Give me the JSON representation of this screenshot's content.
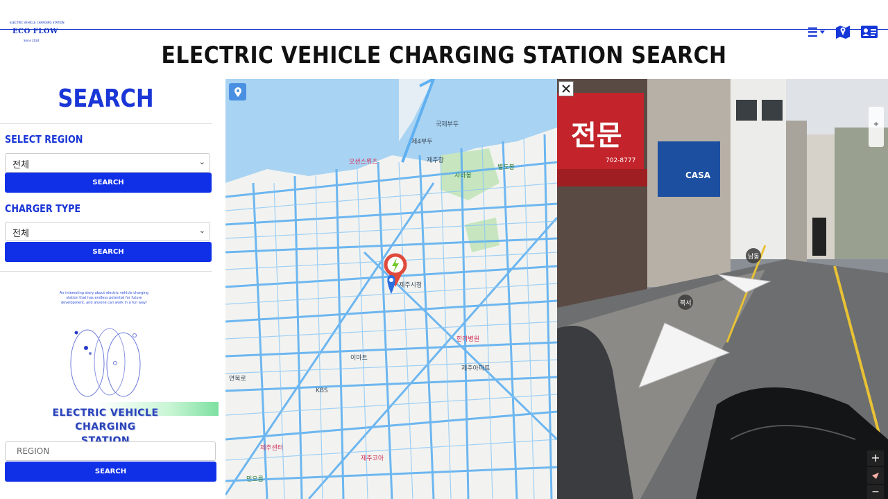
{
  "header": {
    "logo_tagline": "ELECTRIC VEHICLE CHARGING STATION",
    "logo_name": "ECO FLOW",
    "logo_since": "Since 2024",
    "title": "ELECTRIC VEHICLE CHARGING STATION SEARCH",
    "icons": [
      "menu-dropdown-icon",
      "map-icon",
      "id-card-icon"
    ]
  },
  "sidebar": {
    "heading": "SEARCH",
    "region_label": "SELECT REGION",
    "region_value": "전체",
    "region_button": "SEARCH",
    "charger_label": "CHARGER TYPE",
    "charger_value": "전체",
    "charger_button": "SEARCH",
    "story_text": "An interesting story about electric vehicle charging station that has endless potential for future development, and anyone can work in a fun way!",
    "ev_label_line1": "ELECTRIC VEHICLE CHARGING",
    "ev_label_line2": "STATION",
    "region_input_placeholder": "REGION",
    "bottom_button": "SEARCH"
  },
  "map": {
    "labels": [
      {
        "text": "국제부두",
        "id": "l1"
      },
      {
        "text": "제4부두",
        "id": "l2"
      },
      {
        "text": "제주항",
        "id": "l3"
      },
      {
        "text": "오션스위츠",
        "id": "l4"
      },
      {
        "text": "사라봉",
        "id": "l5"
      },
      {
        "text": "별도봉",
        "id": "l6"
      },
      {
        "text": "제주시청",
        "id": "l7"
      },
      {
        "text": "한라병원",
        "id": "l8"
      },
      {
        "text": "제주아파트",
        "id": "l9"
      },
      {
        "text": "이마트",
        "id": "l10"
      },
      {
        "text": "민오름",
        "id": "l11"
      },
      {
        "text": "제주코아",
        "id": "l12"
      },
      {
        "text": "제주센터",
        "id": "l13"
      },
      {
        "text": "KBS",
        "id": "l14"
      },
      {
        "text": "연북로",
        "id": "l15"
      }
    ],
    "accent": "#4aa8f0"
  },
  "street_view": {
    "signs": [
      "전문",
      "CASA",
      "702-8777"
    ],
    "direction_labels": [
      "남동",
      "북서"
    ],
    "controls": {
      "zoom_in": "+",
      "zoom_out": "−",
      "mini_plus": "+"
    }
  }
}
